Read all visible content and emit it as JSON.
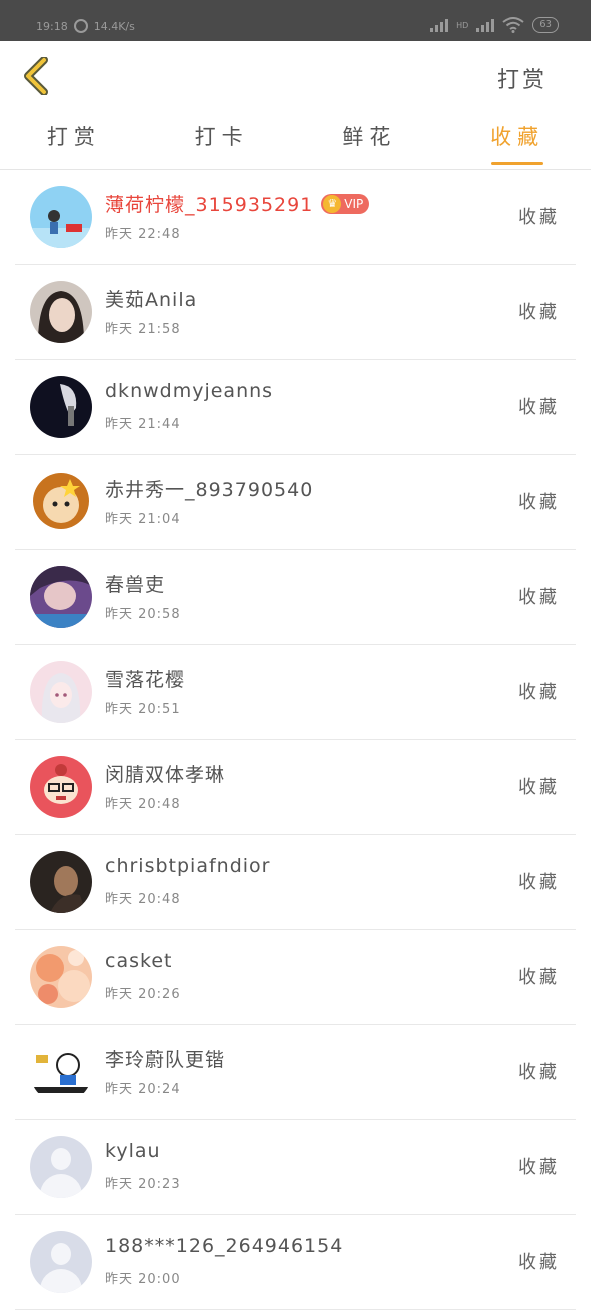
{
  "status_bar": {
    "time": "19:18",
    "speed": "14.4K/s",
    "network_label": "HD",
    "battery": "63"
  },
  "header": {
    "action_label": "打赏"
  },
  "tabs": [
    {
      "label": "打赏"
    },
    {
      "label": "打卡"
    },
    {
      "label": "鲜花"
    },
    {
      "label": "收藏"
    }
  ],
  "active_tab": "收藏",
  "vip_label": "VIP",
  "colors": {
    "accent": "#f0a22e",
    "vip_name": "#e8463c",
    "vip_badge": "#ee6a5f"
  },
  "rows": [
    {
      "name": "薄荷柠檬_315935291",
      "time": "昨天 22:48",
      "action": "收藏",
      "vip": true
    },
    {
      "name": "美茹Anila",
      "time": "昨天 21:58",
      "action": "收藏"
    },
    {
      "name": "dknwdmyjeanns",
      "time": "昨天 21:44",
      "action": "收藏"
    },
    {
      "name": "赤井秀一_893790540",
      "time": "昨天 21:04",
      "action": "收藏"
    },
    {
      "name": "春兽吏",
      "time": "昨天 20:58",
      "action": "收藏"
    },
    {
      "name": "雪落花樱",
      "time": "昨天 20:51",
      "action": "收藏"
    },
    {
      "name": "闵腈双体孝琳",
      "time": "昨天 20:48",
      "action": "收藏"
    },
    {
      "name": "chrisbtpiafndior",
      "time": "昨天 20:48",
      "action": "收藏"
    },
    {
      "name": "casket",
      "time": "昨天 20:26",
      "action": "收藏"
    },
    {
      "name": "李玲蔚队更锴",
      "time": "昨天 20:24",
      "action": "收藏"
    },
    {
      "name": "kylau",
      "time": "昨天 20:23",
      "action": "收藏"
    },
    {
      "name": "188***126_264946154",
      "time": "昨天 20:00",
      "action": "收藏"
    }
  ]
}
